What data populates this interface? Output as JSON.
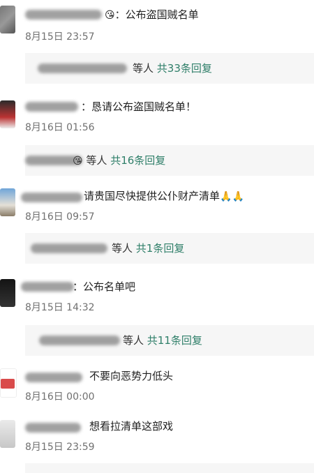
{
  "comments": [
    {
      "emoji": "😘",
      "text": "：公布盗国贼名单",
      "time": "8月15日 23:57",
      "reply": {
        "others": "等人",
        "count_label": "共33条回复"
      }
    },
    {
      "text": "：恳请公布盗国贼名单！",
      "time": "8月16日 01:56",
      "reply": {
        "emoji": "😘",
        "others": "等人",
        "count_label": "共16条回复"
      }
    },
    {
      "text": "请贵国尽快提供公仆财产清单",
      "emoji": "🙏🙏",
      "time": "8月16日 09:57",
      "reply": {
        "others": "等人",
        "count_label": "共1条回复"
      }
    },
    {
      "text": "：公布名单吧",
      "time": "8月15日 14:32",
      "reply": {
        "others": "等人",
        "count_label": "共11条回复"
      }
    },
    {
      "text": "不要向恶势力低头",
      "time": "8月16日 00:00"
    },
    {
      "text": "想看拉清单这部戏",
      "time": "8月15日 23:59"
    }
  ]
}
